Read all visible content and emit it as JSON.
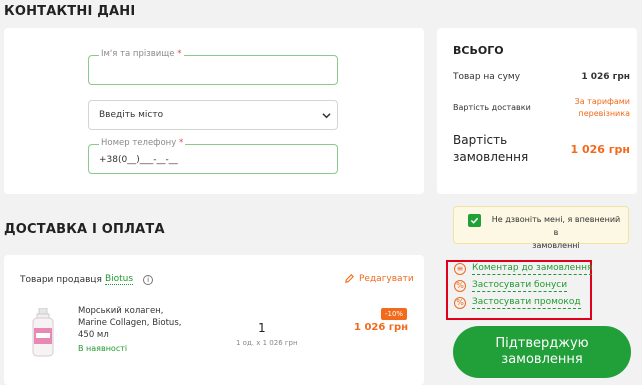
{
  "contacts": {
    "title": "КОНТАКТНІ ДАНІ",
    "name_label": "Ім'я та прізвище",
    "required_mark": "*",
    "city_value": "Введіть місто",
    "phone_label": "Номер телефону",
    "phone_value": "+38(0__)___-__-__"
  },
  "delivery": {
    "title": "ДОСТАВКА І ОПЛАТА",
    "seller_prefix": "Товари продавця",
    "seller_name": "Biotus",
    "edit_label": "Редагувати",
    "product": {
      "name_line1": "Морський колаген,",
      "name_line2": "Marine Collagen, Biotus,",
      "name_line3": "450 мл",
      "availability": "В наявності",
      "qty": "1",
      "unit_price": "1 од. x 1 026 грн",
      "discount": "-10%",
      "price": "1 026 грн"
    }
  },
  "summary": {
    "title": "ВСЬОГО",
    "goods_label": "Товар на суму",
    "goods_value": "1 026 грн",
    "shipping_label": "Вартість доставки",
    "shipping_value_line1": "За тарифами",
    "shipping_value_line2": "перевізника",
    "order_cost_line1": "Вартість",
    "order_cost_line2": "замовлення",
    "order_cost_value": "1 026 грн",
    "no_call_line1": "Не дзвоніть мені, я впевнений в",
    "no_call_line2": "замовленні",
    "no_call_checked": true,
    "links": {
      "comment": "Коментар до замовлення",
      "bonuses": "Застосувати бонуси",
      "promo": "Застосувати промокод"
    },
    "confirm_line1": "Підтверджую",
    "confirm_line2": "замовлення"
  },
  "colors": {
    "accent_green": "#1f9a2f",
    "accent_orange": "#f26a1b",
    "highlight_red": "#e0001b",
    "button_green": "#21a03a"
  }
}
